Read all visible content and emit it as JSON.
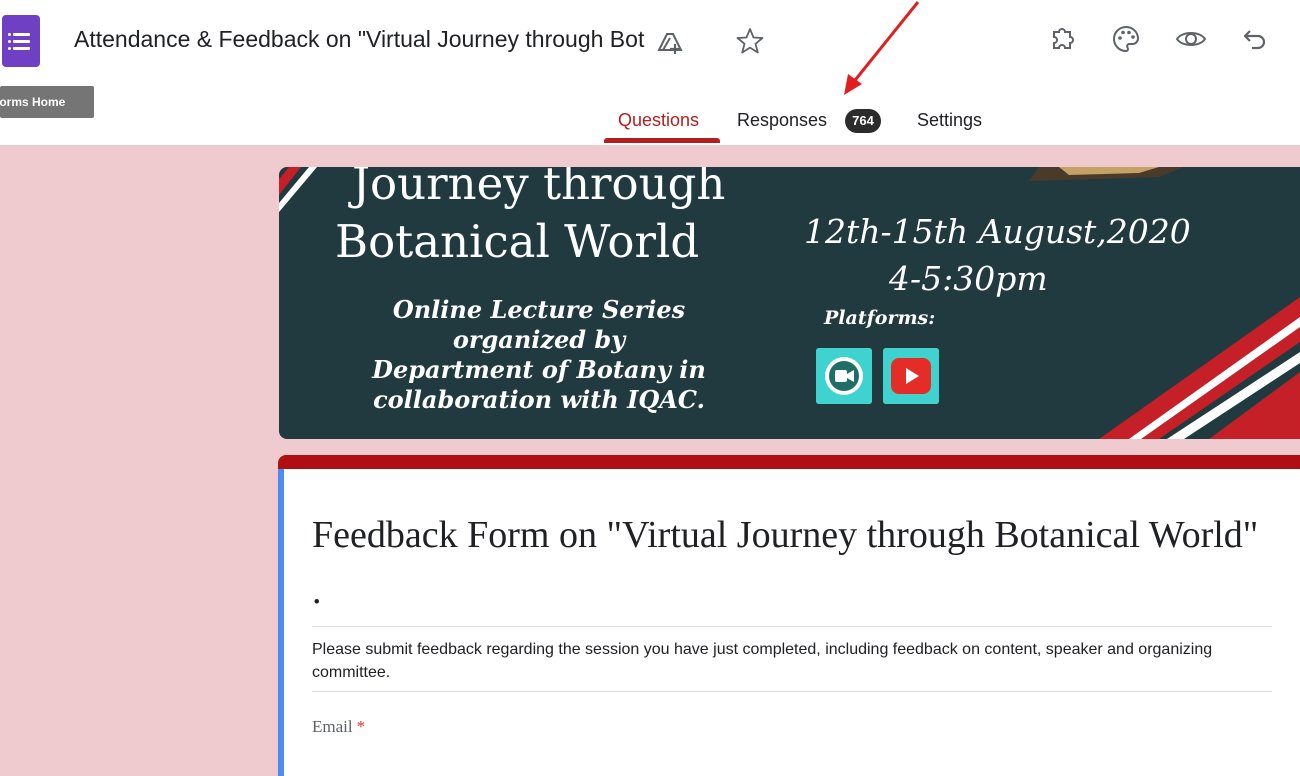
{
  "header": {
    "app_icon": "google-forms-icon",
    "title": "Attendance & Feedback on \"Virtual Journey through Bot",
    "title_icons": [
      "add-to-drive-icon",
      "star-icon"
    ],
    "toolbar_icons": [
      "addon-puzzle-icon",
      "palette-icon",
      "preview-eye-icon",
      "undo-icon"
    ],
    "tooltip": "Forms Home"
  },
  "tabs": {
    "questions": "Questions",
    "responses": "Responses",
    "responses_count": "764",
    "settings": "Settings",
    "active": "Questions"
  },
  "banner": {
    "title_line1": "Journey through",
    "title_line2": "Botanical World",
    "subtitle_line1": "Online Lecture Series",
    "subtitle_line2": "organized by",
    "subtitle_line3": "Department of Botany in",
    "subtitle_line4": "collaboration with IQAC.",
    "date": "12th-15th August,2020",
    "time": "4-5:30pm",
    "platforms_label": "Platforms:",
    "platform_icons": [
      "google-meet-icon",
      "youtube-icon"
    ]
  },
  "form": {
    "title": "Feedback Form on \"Virtual Journey through Botanical World\" .",
    "description": "Please submit feedback regarding the session you have just completed, including feedback on content, speaker and organizing committee.",
    "email_label": "Email",
    "required_marker": "*"
  },
  "colors": {
    "accent": "#b21f1f",
    "theme_background": "#efcbcf",
    "header_strip": "#b00e10",
    "focus_strip": "#4b8cf5",
    "banner_background": "#203a40",
    "forms_purple": "#6f3fc4",
    "annotation_arrow": "#e02020"
  }
}
